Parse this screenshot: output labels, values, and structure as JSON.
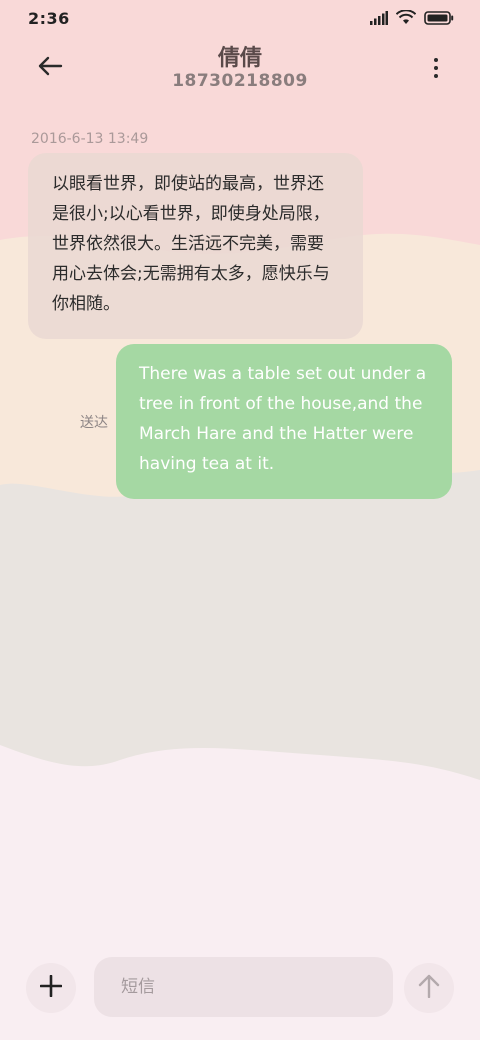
{
  "status_bar": {
    "time": "2:36",
    "icons": [
      "signal-icon",
      "wifi-icon",
      "battery-icon"
    ]
  },
  "header": {
    "contact_name": "倩倩",
    "contact_number": "18730218809",
    "icons": [
      "back-arrow-icon",
      "more-vertical-icon"
    ]
  },
  "conversation": {
    "timestamp": "2016-6-13 13:49",
    "incoming_message": "以眼看世界，即使站的最高，世界还是很小;以心看世界，即使身处局限，世界依然很大。生活远不完美，需要用心去体会;无需拥有太多，愿快乐与你相随。",
    "outgoing_message": "There was a table set out under a tree in front of the house,and the March Hare and the Hatter were having tea at it.",
    "outgoing_status": "送达"
  },
  "composer": {
    "placeholder": "短信",
    "value": "",
    "icons": [
      "plus-icon",
      "send-arrow-icon"
    ]
  },
  "colors": {
    "background_top": "#f9d9d8",
    "background_band": "#f8e8da",
    "background_middle": "#e9e4e0",
    "background_bottom": "#f9eef2",
    "incoming_bubble": "#ead8d2",
    "outgoing_bubble": "#a5d8a3"
  }
}
